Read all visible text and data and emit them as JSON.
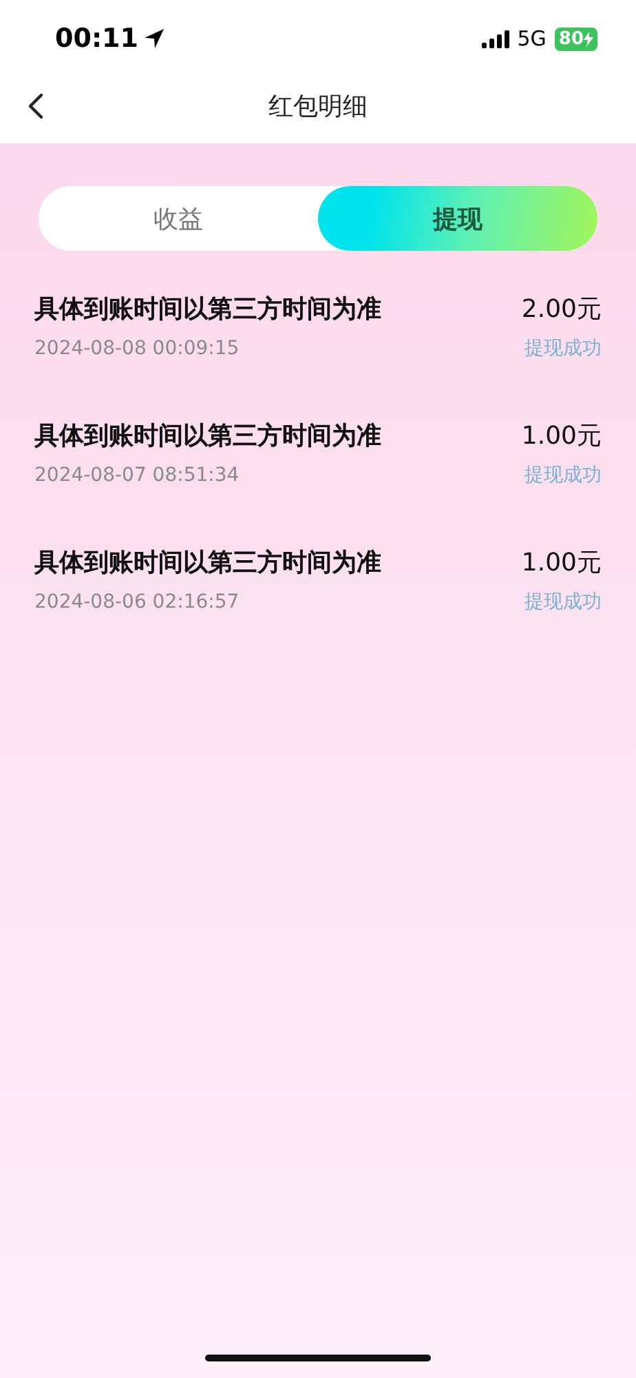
{
  "status_bar": {
    "time": "00:11",
    "network": "5G",
    "battery": "80"
  },
  "nav": {
    "title": "红包明细"
  },
  "tabs": [
    {
      "label": "收益",
      "selected": false
    },
    {
      "label": "提现",
      "selected": true
    }
  ],
  "records": [
    {
      "title": "具体到账时间以第三方时间为准",
      "time": "2024-08-08 00:09:15",
      "amount": "2.00元",
      "status": "提现成功"
    },
    {
      "title": "具体到账时间以第三方时间为准",
      "time": "2024-08-07 08:51:34",
      "amount": "1.00元",
      "status": "提现成功"
    },
    {
      "title": "具体到账时间以第三方时间为准",
      "time": "2024-08-06 02:16:57",
      "amount": "1.00元",
      "status": "提现成功"
    }
  ]
}
